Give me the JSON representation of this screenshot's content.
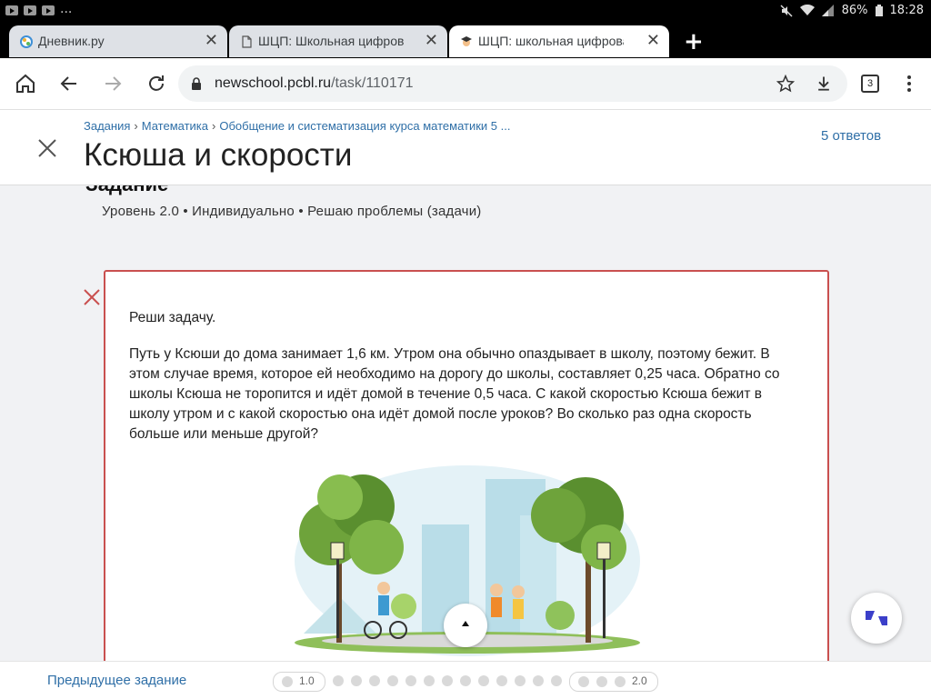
{
  "status_bar": {
    "overflow": "...",
    "battery": "86%",
    "time": "18:28"
  },
  "tabs": [
    {
      "title": "Дневник.ру",
      "icon": "dnevnik-icon"
    },
    {
      "title": "ШЦП: Школьная цифровая",
      "icon": "document-icon"
    },
    {
      "title": "ШЦП: школьная цифровая",
      "icon": "graduate-icon",
      "active": true
    }
  ],
  "toolbar": {
    "url_host": "newschool.pcbl.ru",
    "url_path": "/task/110171",
    "tab_count": "3"
  },
  "header": {
    "breadcrumbs": [
      "Задания",
      "Математика",
      "Обобщение и систематизация курса математики 5 ..."
    ],
    "title": "Ксюша и скорости",
    "answers_link": "5 ответов"
  },
  "task": {
    "section_title": "Задание",
    "meta": "Уровень 2.0 • Индивидуально  • Решаю проблемы (задачи)",
    "prompt": "Реши задачу.",
    "problem": "Путь у Ксюши до дома занимает 1,6 км. Утром она обычно опаздывает в школу, поэтому бежит. В этом случае время, которое ей необходимо на дорогу до школы, составляет 0,25 часа. Обратно со школы Ксюша не торопится и идёт домой в течение 0,5 часа. С какой скоростью Ксюша бежит в школу утром и с какой скоростью она идёт домой после уроков? Во сколько раз одна скорость больше или меньше другой?"
  },
  "bottom": {
    "prev_label": "Предыдущее задание",
    "level_start": "1.0",
    "level_end": "2.0"
  },
  "colors": {
    "accent": "#2f6fa7",
    "error_border": "#c9504f",
    "fab_icon": "#3b3fc9"
  }
}
